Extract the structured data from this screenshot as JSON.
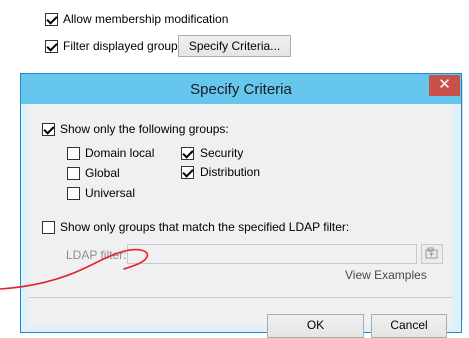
{
  "background": {
    "allow_membership": {
      "label": "Allow membership modification",
      "checked": true
    },
    "filter_groups": {
      "label": "Filter displayed groups",
      "checked": true
    },
    "specify_button": "Specify Criteria..."
  },
  "dialog": {
    "title": "Specify Criteria",
    "close_glyph": "✕",
    "show_following": {
      "label": "Show only the following groups:",
      "checked": true
    },
    "scopes": [
      {
        "label": "Domain local",
        "checked": false
      },
      {
        "label": "Global",
        "checked": false
      },
      {
        "label": "Universal",
        "checked": false
      }
    ],
    "types": [
      {
        "label": "Security",
        "checked": true
      },
      {
        "label": "Distribution",
        "checked": true
      }
    ],
    "ldap_option": {
      "label": "Show only groups that match the specified LDAP filter:",
      "checked": false
    },
    "ldap_label": "LDAP filter:",
    "ldap_value": "",
    "view_examples": "View Examples",
    "ok_label": "OK",
    "cancel_label": "Cancel"
  },
  "colors": {
    "titlebar": "#67c6ee",
    "close": "#c7504a",
    "annotation": "#e0242a"
  }
}
